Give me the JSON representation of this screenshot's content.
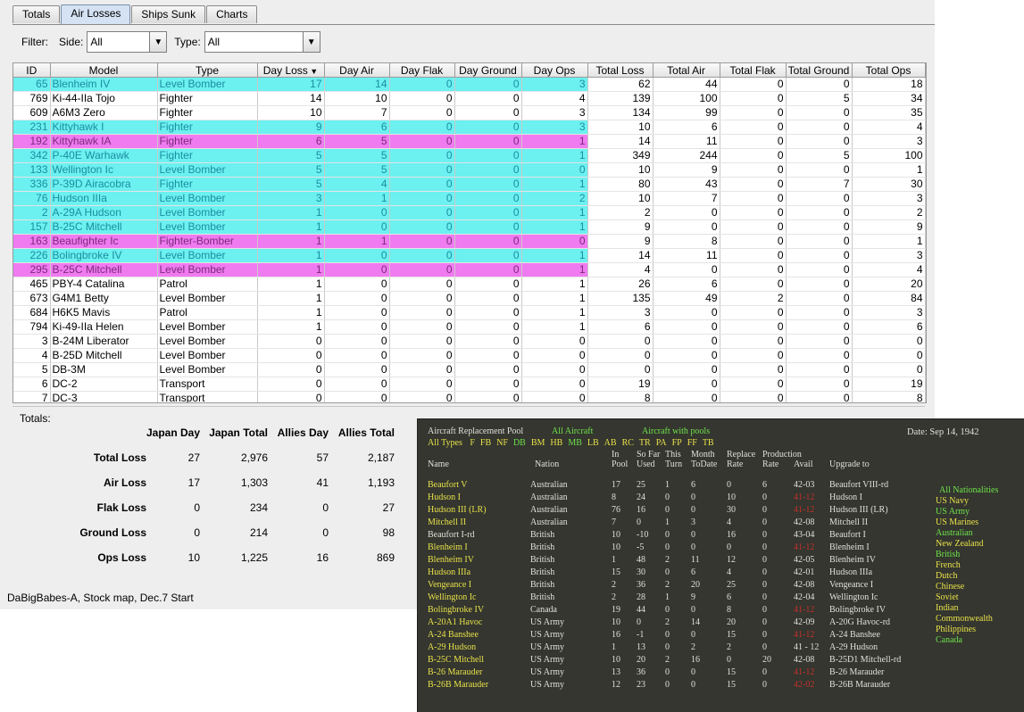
{
  "tabs": [
    "Totals",
    "Air Losses",
    "Ships Sunk",
    "Charts"
  ],
  "active_tab": "Air Losses",
  "filter": {
    "label": "Filter:",
    "side_label": "Side:",
    "side_value": "All",
    "type_label": "Type:",
    "type_value": "All"
  },
  "columns": [
    "ID",
    "Model",
    "Type",
    "Day Loss",
    "Day Air",
    "Day Flak",
    "Day Ground",
    "Day Ops",
    "Total Loss",
    "Total Air",
    "Total Flak",
    "Total Ground",
    "Total Ops"
  ],
  "sort_column": "Day Loss",
  "rows": [
    {
      "id": "65",
      "model": "Blenheim IV",
      "type": "Level Bomber",
      "v": [
        "17",
        "14",
        "0",
        "0",
        "3",
        "62",
        "44",
        "0",
        "0",
        "18"
      ],
      "hl": "cyan"
    },
    {
      "id": "769",
      "model": "Ki-44-IIa Tojo",
      "type": "Fighter",
      "v": [
        "14",
        "10",
        "0",
        "0",
        "4",
        "139",
        "100",
        "0",
        "5",
        "34"
      ],
      "hl": ""
    },
    {
      "id": "609",
      "model": "A6M3 Zero",
      "type": "Fighter",
      "v": [
        "10",
        "7",
        "0",
        "0",
        "3",
        "134",
        "99",
        "0",
        "0",
        "35"
      ],
      "hl": ""
    },
    {
      "id": "231",
      "model": "Kittyhawk I",
      "type": "Fighter",
      "v": [
        "9",
        "6",
        "0",
        "0",
        "3",
        "10",
        "6",
        "0",
        "0",
        "4"
      ],
      "hl": "cyan"
    },
    {
      "id": "192",
      "model": "Kittyhawk IA",
      "type": "Fighter",
      "v": [
        "6",
        "5",
        "0",
        "0",
        "1",
        "14",
        "11",
        "0",
        "0",
        "3"
      ],
      "hl": "magenta"
    },
    {
      "id": "342",
      "model": "P-40E Warhawk",
      "type": "Fighter",
      "v": [
        "5",
        "5",
        "0",
        "0",
        "1",
        "349",
        "244",
        "0",
        "5",
        "100"
      ],
      "hl": "cyan"
    },
    {
      "id": "133",
      "model": "Wellington Ic",
      "type": "Level Bomber",
      "v": [
        "5",
        "5",
        "0",
        "0",
        "0",
        "10",
        "9",
        "0",
        "0",
        "1"
      ],
      "hl": "cyan"
    },
    {
      "id": "336",
      "model": "P-39D Airacobra",
      "type": "Fighter",
      "v": [
        "5",
        "4",
        "0",
        "0",
        "1",
        "80",
        "43",
        "0",
        "7",
        "30"
      ],
      "hl": "cyan"
    },
    {
      "id": "76",
      "model": "Hudson IIIa",
      "type": "Level Bomber",
      "v": [
        "3",
        "1",
        "0",
        "0",
        "2",
        "10",
        "7",
        "0",
        "0",
        "3"
      ],
      "hl": "cyan"
    },
    {
      "id": "2",
      "model": "A-29A Hudson",
      "type": "Level Bomber",
      "v": [
        "1",
        "0",
        "0",
        "0",
        "1",
        "2",
        "0",
        "0",
        "0",
        "2"
      ],
      "hl": "cyan"
    },
    {
      "id": "157",
      "model": "B-25C Mitchell",
      "type": "Level Bomber",
      "v": [
        "1",
        "0",
        "0",
        "0",
        "1",
        "9",
        "0",
        "0",
        "0",
        "9"
      ],
      "hl": "cyan"
    },
    {
      "id": "163",
      "model": "Beaufighter Ic",
      "type": "Fighter-Bomber",
      "v": [
        "1",
        "1",
        "0",
        "0",
        "0",
        "9",
        "8",
        "0",
        "0",
        "1"
      ],
      "hl": "magenta"
    },
    {
      "id": "226",
      "model": "Bolingbroke IV",
      "type": "Level Bomber",
      "v": [
        "1",
        "0",
        "0",
        "0",
        "1",
        "14",
        "11",
        "0",
        "0",
        "3"
      ],
      "hl": "cyan"
    },
    {
      "id": "295",
      "model": "B-25C Mitchell",
      "type": "Level Bomber",
      "v": [
        "1",
        "0",
        "0",
        "0",
        "1",
        "4",
        "0",
        "0",
        "0",
        "4"
      ],
      "hl": "magenta"
    },
    {
      "id": "465",
      "model": "PBY-4 Catalina",
      "type": "Patrol",
      "v": [
        "1",
        "0",
        "0",
        "0",
        "1",
        "26",
        "6",
        "0",
        "0",
        "20"
      ],
      "hl": ""
    },
    {
      "id": "673",
      "model": "G4M1 Betty",
      "type": "Level Bomber",
      "v": [
        "1",
        "0",
        "0",
        "0",
        "1",
        "135",
        "49",
        "2",
        "0",
        "84"
      ],
      "hl": ""
    },
    {
      "id": "684",
      "model": "H6K5 Mavis",
      "type": "Patrol",
      "v": [
        "1",
        "0",
        "0",
        "0",
        "1",
        "3",
        "0",
        "0",
        "0",
        "3"
      ],
      "hl": ""
    },
    {
      "id": "794",
      "model": "Ki-49-IIa Helen",
      "type": "Level Bomber",
      "v": [
        "1",
        "0",
        "0",
        "0",
        "1",
        "6",
        "0",
        "0",
        "0",
        "6"
      ],
      "hl": ""
    },
    {
      "id": "3",
      "model": "B-24M Liberator",
      "type": "Level Bomber",
      "v": [
        "0",
        "0",
        "0",
        "0",
        "0",
        "0",
        "0",
        "0",
        "0",
        "0"
      ],
      "hl": ""
    },
    {
      "id": "4",
      "model": "B-25D Mitchell",
      "type": "Level Bomber",
      "v": [
        "0",
        "0",
        "0",
        "0",
        "0",
        "0",
        "0",
        "0",
        "0",
        "0"
      ],
      "hl": ""
    },
    {
      "id": "5",
      "model": "DB-3M",
      "type": "Level Bomber",
      "v": [
        "0",
        "0",
        "0",
        "0",
        "0",
        "0",
        "0",
        "0",
        "0",
        "0"
      ],
      "hl": ""
    },
    {
      "id": "6",
      "model": "DC-2",
      "type": "Transport",
      "v": [
        "0",
        "0",
        "0",
        "0",
        "0",
        "19",
        "0",
        "0",
        "0",
        "19"
      ],
      "hl": ""
    },
    {
      "id": "7",
      "model": "DC-3",
      "type": "Transport",
      "v": [
        "0",
        "0",
        "0",
        "0",
        "0",
        "8",
        "0",
        "0",
        "0",
        "8"
      ],
      "hl": ""
    }
  ],
  "totals": {
    "title": "Totals:",
    "headers": [
      "Japan Day",
      "Japan Total",
      "Allies Day",
      "Allies Total"
    ],
    "rows": [
      {
        "label": "Total Loss",
        "v": [
          "27",
          "2,976",
          "57",
          "2,187"
        ]
      },
      {
        "label": "Air Loss",
        "v": [
          "17",
          "1,303",
          "41",
          "1,193"
        ]
      },
      {
        "label": "Flak Loss",
        "v": [
          "0",
          "234",
          "0",
          "27"
        ]
      },
      {
        "label": "Ground Loss",
        "v": [
          "0",
          "214",
          "0",
          "98"
        ]
      },
      {
        "label": "Ops Loss",
        "v": [
          "10",
          "1,225",
          "16",
          "869"
        ]
      }
    ]
  },
  "status": "DaBigBabes-A, Stock map, Dec.7 Start",
  "pool": {
    "title": "Aircraft Replacement Pool",
    "all_aircraft": "All Aircraft",
    "with_pools": "Aircraft with pools",
    "date": "Date: Sep 14, 1942",
    "types_all": "All Types",
    "types": [
      {
        "t": "F",
        "c": "y"
      },
      {
        "t": "FB",
        "c": "y"
      },
      {
        "t": "NF",
        "c": "y"
      },
      {
        "t": "DB",
        "c": "g"
      },
      {
        "t": "BM",
        "c": "y"
      },
      {
        "t": "HB",
        "c": "y"
      },
      {
        "t": "MB",
        "c": "g"
      },
      {
        "t": "LB",
        "c": "y"
      },
      {
        "t": "AB",
        "c": "y"
      },
      {
        "t": "RC",
        "c": "y"
      },
      {
        "t": "TR",
        "c": "y"
      },
      {
        "t": "PA",
        "c": "y"
      },
      {
        "t": "FP",
        "c": "y"
      },
      {
        "t": "FF",
        "c": "y"
      },
      {
        "t": "TB",
        "c": "y"
      }
    ],
    "headers": {
      "name": "Name",
      "nation": "Nation",
      "in_pool": [
        "In",
        "Pool"
      ],
      "so_far": [
        "So Far",
        "Used"
      ],
      "this_turn": [
        "This",
        "Turn"
      ],
      "month": [
        "Month",
        "ToDate"
      ],
      "replace": [
        "Replace",
        "Rate"
      ],
      "production": "Production",
      "prod_rate": "Rate",
      "avail": "Avail",
      "upgrade": "Upgrade to"
    },
    "rows": [
      {
        "name": "Beaufort V",
        "nation": "Australian",
        "v": [
          "17",
          "25",
          "1",
          "6",
          "0",
          "6"
        ],
        "avail": "42-03",
        "ar": false,
        "up": "Beaufort VIII-rd",
        "nc": "y"
      },
      {
        "name": "Hudson I",
        "nation": "Australian",
        "v": [
          "8",
          "24",
          "0",
          "0",
          "10",
          "0"
        ],
        "avail": "41-12",
        "ar": true,
        "up": "Hudson I",
        "nc": "y"
      },
      {
        "name": "Hudson III (LR)",
        "nation": "Australian",
        "v": [
          "76",
          "16",
          "0",
          "0",
          "30",
          "0"
        ],
        "avail": "41-12",
        "ar": true,
        "up": "Hudson III (LR)",
        "nc": "y"
      },
      {
        "name": "Mitchell II",
        "nation": "Australian",
        "v": [
          "7",
          "0",
          "1",
          "3",
          "4",
          "0"
        ],
        "avail": "42-08",
        "ar": false,
        "up": "Mitchell II",
        "nc": "y"
      },
      {
        "name": "Beaufort I-rd",
        "nation": "British",
        "v": [
          "10",
          "-10",
          "0",
          "0",
          "16",
          "0"
        ],
        "avail": "43-04",
        "ar": false,
        "up": "Beaufort I",
        "nc": "w"
      },
      {
        "name": "Blenheim I",
        "nation": "British",
        "v": [
          "10",
          "-5",
          "0",
          "0",
          "0",
          "0"
        ],
        "avail": "41-12",
        "ar": true,
        "up": "Blenheim I",
        "nc": "y"
      },
      {
        "name": "Blenheim IV",
        "nation": "British",
        "v": [
          "1",
          "48",
          "2",
          "11",
          "12",
          "0"
        ],
        "avail": "42-05",
        "ar": false,
        "up": "Blenheim IV",
        "nc": "y"
      },
      {
        "name": "Hudson IIIa",
        "nation": "British",
        "v": [
          "15",
          "30",
          "0",
          "6",
          "4",
          "0"
        ],
        "avail": "42-01",
        "ar": false,
        "up": "Hudson IIIa",
        "nc": "y"
      },
      {
        "name": "Vengeance I",
        "nation": "British",
        "v": [
          "2",
          "36",
          "2",
          "20",
          "25",
          "0"
        ],
        "avail": "42-08",
        "ar": false,
        "up": "Vengeance I",
        "nc": "y"
      },
      {
        "name": "Wellington Ic",
        "nation": "British",
        "v": [
          "2",
          "28",
          "1",
          "9",
          "6",
          "0"
        ],
        "avail": "42-04",
        "ar": false,
        "up": "Wellington Ic",
        "nc": "y"
      },
      {
        "name": "Bolingbroke IV",
        "nation": "Canada",
        "v": [
          "19",
          "44",
          "0",
          "0",
          "8",
          "0"
        ],
        "avail": "41-12",
        "ar": true,
        "up": "Bolingbroke IV",
        "nc": "y"
      },
      {
        "name": "A-20A1 Havoc",
        "nation": "US Army",
        "v": [
          "10",
          "0",
          "2",
          "14",
          "20",
          "0"
        ],
        "avail": "42-09",
        "ar": false,
        "up": "A-20G Havoc-rd",
        "nc": "y"
      },
      {
        "name": "A-24 Banshee",
        "nation": "US Army",
        "v": [
          "16",
          "-1",
          "0",
          "0",
          "15",
          "0"
        ],
        "avail": "41-12",
        "ar": true,
        "up": "A-24 Banshee",
        "nc": "y"
      },
      {
        "name": "A-29 Hudson",
        "nation": "US Army",
        "v": [
          "1",
          "13",
          "0",
          "2",
          "2",
          "0"
        ],
        "avail": "41 - 12",
        "ar": false,
        "up": "A-29 Hudson",
        "nc": "y"
      },
      {
        "name": "B-25C Mitchell",
        "nation": "US Army",
        "v": [
          "10",
          "20",
          "2",
          "16",
          "0",
          "20"
        ],
        "avail": "42-08",
        "ar": false,
        "up": "B-25D1 Mitchell-rd",
        "nc": "y"
      },
      {
        "name": "B-26 Marauder",
        "nation": "US Army",
        "v": [
          "13",
          "36",
          "0",
          "0",
          "15",
          "0"
        ],
        "avail": "41-12",
        "ar": true,
        "up": "B-26 Marauder",
        "nc": "y"
      },
      {
        "name": "B-26B Marauder",
        "nation": "US Army",
        "v": [
          "12",
          "23",
          "0",
          "0",
          "15",
          "0"
        ],
        "avail": "42-02",
        "ar": true,
        "up": "B-26B Marauder",
        "nc": "y"
      }
    ],
    "nationalities": [
      {
        "t": "All Nationalities",
        "c": "g"
      },
      {
        "t": "US Navy",
        "c": "y"
      },
      {
        "t": "US Army",
        "c": "g"
      },
      {
        "t": "US Marines",
        "c": "y"
      },
      {
        "t": "Australian",
        "c": "g"
      },
      {
        "t": "New Zealand",
        "c": "y"
      },
      {
        "t": "British",
        "c": "g"
      },
      {
        "t": "French",
        "c": "y"
      },
      {
        "t": "Dutch",
        "c": "y"
      },
      {
        "t": "Chinese",
        "c": "y"
      },
      {
        "t": "Soviet",
        "c": "y"
      },
      {
        "t": "Indian",
        "c": "y"
      },
      {
        "t": "Commonwealth",
        "c": "y"
      },
      {
        "t": "Philippines",
        "c": "y"
      },
      {
        "t": "Canada",
        "c": "g"
      }
    ]
  }
}
